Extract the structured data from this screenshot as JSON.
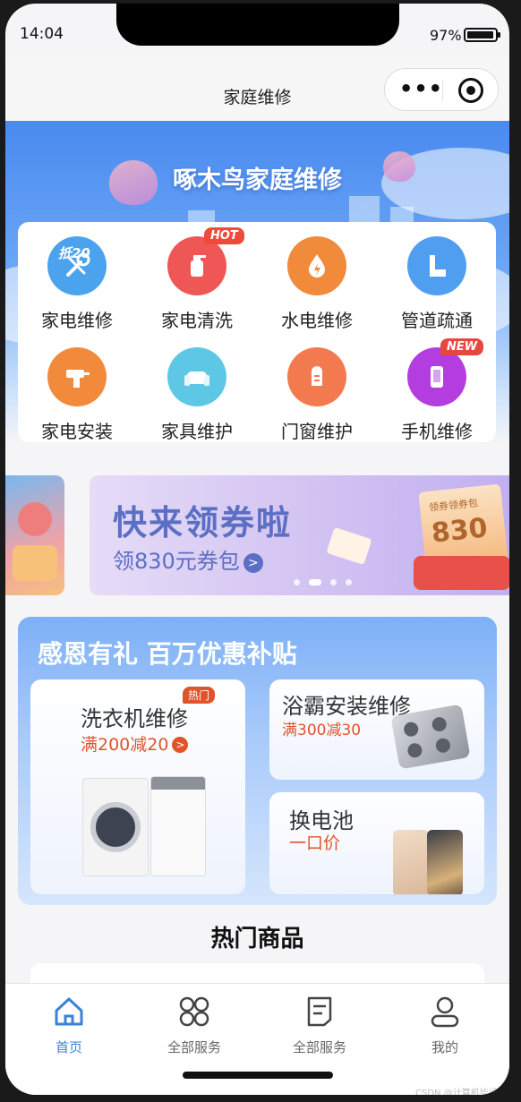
{
  "status": {
    "time": "14:04",
    "battery": "97%"
  },
  "navbar": {
    "title": "家庭维修"
  },
  "banner": {
    "title": "啄木鸟家庭维修"
  },
  "categories": [
    {
      "label": "家电维修",
      "icon": "repair-icon",
      "color": "#4aa3ec",
      "badge_text": "抵20"
    },
    {
      "label": "家电清洗",
      "icon": "spray-bottle-icon",
      "color": "#ef5656",
      "tag": "HOT"
    },
    {
      "label": "水电维修",
      "icon": "water-drop-icon",
      "color": "#f28a3c"
    },
    {
      "label": "管道疏通",
      "icon": "pipe-icon",
      "color": "#4f9ef0"
    },
    {
      "label": "家电安装",
      "icon": "drill-icon",
      "color": "#f28a3c"
    },
    {
      "label": "家具维护",
      "icon": "sofa-icon",
      "color": "#5ec7e6"
    },
    {
      "label": "门窗维护",
      "icon": "door-icon",
      "color": "#f27a4e"
    },
    {
      "label": "手机维修",
      "icon": "phone-icon",
      "color": "#b43de0",
      "tag": "NEW"
    }
  ],
  "promo": {
    "title": "快来领券啦",
    "subtitle": "领830元券包",
    "coupon_label": "领券领券包",
    "coupon_value": "830",
    "active_index": 1,
    "dots": 4
  },
  "thanks": {
    "title": "感恩有礼 百万优惠补贴",
    "cards": [
      {
        "title": "洗衣机维修",
        "sub": "满200减20",
        "tag": "热门"
      },
      {
        "title": "浴霸安装维修",
        "sub": "满300减30"
      },
      {
        "title": "换电池",
        "sub": "一口价"
      }
    ]
  },
  "hot_goods": {
    "title": "热门商品"
  },
  "tabs": [
    {
      "label": "首页",
      "icon": "home-icon",
      "active": true
    },
    {
      "label": "全部服务",
      "icon": "grid-icon",
      "active": false
    },
    {
      "label": "全部服务",
      "icon": "document-icon",
      "active": false
    },
    {
      "label": "我的",
      "icon": "user-icon",
      "active": false
    }
  ],
  "colors": {
    "accent": "#3b82d8",
    "discount": "#e0542c",
    "promo_text": "#5b6fc4"
  },
  "watermark": "CSDN @计算机毕设专家"
}
